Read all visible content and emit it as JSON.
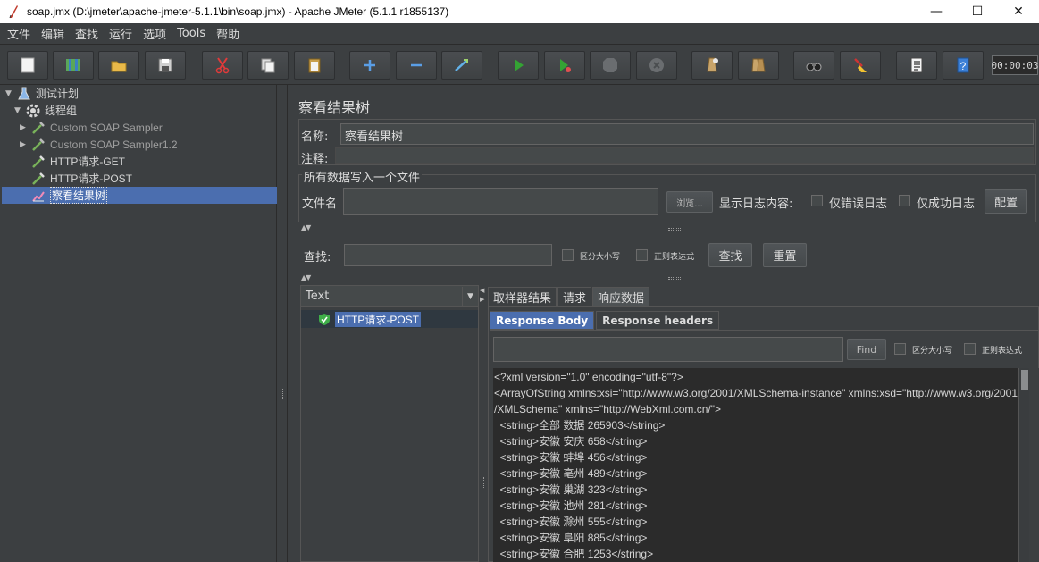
{
  "window": {
    "title": "soap.jmx (D:\\jmeter\\apache-jmeter-5.1.1\\bin\\soap.jmx) - Apache JMeter (5.1.1 r1855137)",
    "minimize": "—",
    "maximize": "☐",
    "close": "✕"
  },
  "menu": [
    "文件",
    "编辑",
    "查找",
    "运行",
    "选项",
    "Tools",
    "帮助"
  ],
  "toolbar": {
    "timer": "00:00:03",
    "buttons": [
      "new-icon",
      "templates-icon",
      "open-icon",
      "save-icon",
      "cut-icon",
      "copy-icon",
      "paste-icon",
      "expand-icon",
      "collapse-icon",
      "toggle-icon",
      "start-icon",
      "start-no-pause-icon",
      "stop-icon",
      "shutdown-icon",
      "clear-icon",
      "clear-all-icon",
      "search-icon",
      "reset-search-icon",
      "function-helper-icon",
      "help-icon"
    ]
  },
  "tree": {
    "items": [
      {
        "label": "测试计划",
        "level": 0,
        "expanded": true
      },
      {
        "label": "线程组",
        "level": 1,
        "expanded": true
      },
      {
        "label": "Custom SOAP Sampler",
        "level": 2,
        "expanded": false,
        "disabled": true
      },
      {
        "label": "Custom SOAP Sampler1.2",
        "level": 2,
        "expanded": false,
        "disabled": true
      },
      {
        "label": "HTTP请求-GET",
        "level": 2
      },
      {
        "label": "HTTP请求-POST",
        "level": 2
      },
      {
        "label": "察看结果树",
        "level": 2,
        "selected": true
      }
    ]
  },
  "panel": {
    "title": "察看结果树",
    "name_label": "名称:",
    "name_value": "察看结果树",
    "comment_label": "注释:",
    "file_section_title": "所有数据写入一个文件",
    "filename_label": "文件名",
    "browse_label": "浏览...",
    "log_display_label": "显示日志内容:",
    "errors_only_label": "仅错误日志",
    "success_only_label": "仅成功日志",
    "configure_label": "配置",
    "search_label": "查找:",
    "case_sensitive_label": "区分大小写",
    "regex_label": "正则表达式",
    "search_button": "查找",
    "reset_button": "重置"
  },
  "results": {
    "renderer": "Text",
    "items": [
      {
        "label": "HTTP请求-POST",
        "status": "success"
      }
    ],
    "tabs": [
      "取样器结果",
      "请求",
      "响应数据"
    ],
    "active_tab": "响应数据",
    "subtabs": [
      "Response Body",
      "Response headers"
    ],
    "active_subtab": "Response Body",
    "find_button": "Find",
    "case_sensitive_label": "区分大小写",
    "regex_label": "正则表达式",
    "body_lines": [
      "<?xml version=\"1.0\" encoding=\"utf-8\"?>",
      "<ArrayOfString xmlns:xsi=\"http://www.w3.org/2001/XMLSchema-instance\" xmlns:xsd=\"http://www.w3.org/2001",
      "/XMLSchema\" xmlns=\"http://WebXml.com.cn/\">",
      "  <string>全部 数据 265903</string>",
      "  <string>安徽 安庆 658</string>",
      "  <string>安徽 蚌埠 456</string>",
      "  <string>安徽 亳州 489</string>",
      "  <string>安徽 巢湖 323</string>",
      "  <string>安徽 池州 281</string>",
      "  <string>安徽 滁州 555</string>",
      "  <string>安徽 阜阳 885</string>",
      "  <string>安徽 合肥 1253</string>"
    ]
  }
}
